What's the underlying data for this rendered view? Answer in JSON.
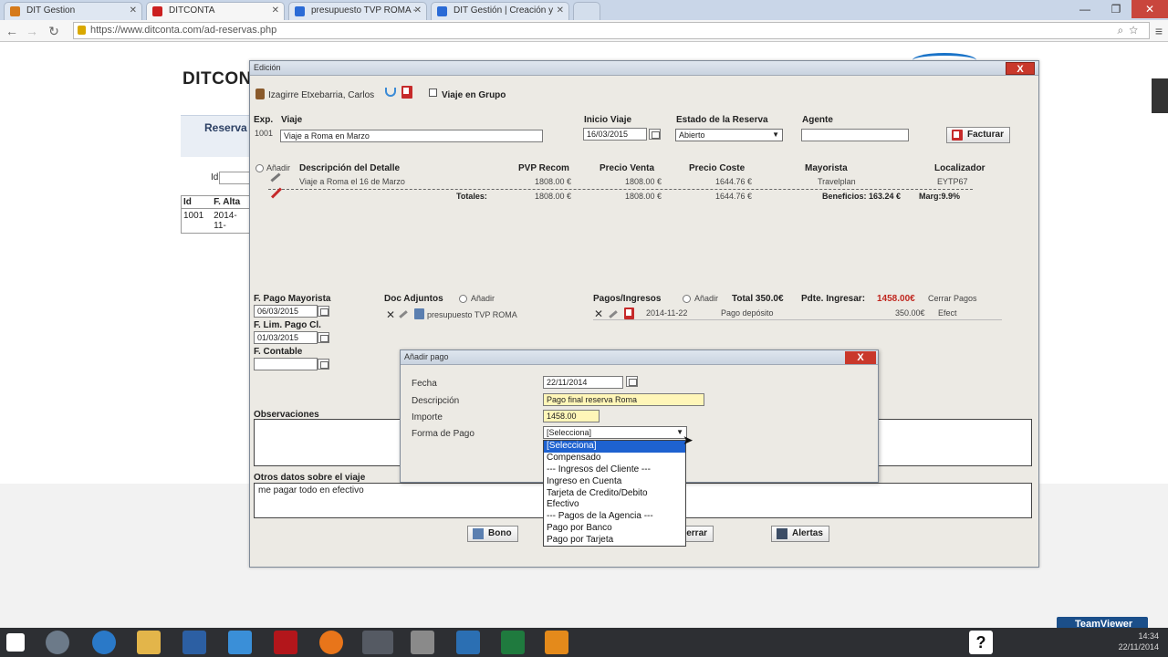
{
  "browser": {
    "tabs": [
      {
        "title": "DIT Gestion",
        "color": "#d57a1b"
      },
      {
        "title": "DITCONTA",
        "color": "#cc2020"
      },
      {
        "title": "presupuesto TVP ROMA -",
        "color": "#2b6bd6"
      },
      {
        "title": "DIT Gestión | Creación y",
        "color": "#2b6bd6"
      }
    ],
    "url": "https://www.ditconta.com/ad-reservas.php",
    "window_controls": [
      "—",
      "❐",
      "✕"
    ]
  },
  "page": {
    "logo": "DITCONTA",
    "nav_label": "Reserva",
    "id_label": "Id",
    "table": {
      "headers": [
        "Id",
        "F. Alta"
      ],
      "rows": [
        [
          "1001",
          "2014-11-"
        ]
      ]
    }
  },
  "edicion": {
    "title": "Edición",
    "close": "X",
    "cliente": "Izagirre Etxebarria, Carlos",
    "viaje_grupo": "Viaje en Grupo",
    "exp_label": "Exp.",
    "exp_value": "1001",
    "viaje_label": "Viaje",
    "viaje_value": "Viaje a Roma en Marzo",
    "inicio_label": "Inicio Viaje",
    "inicio_value": "16/03/2015",
    "estado_label": "Estado de la Reserva",
    "estado_value": "Abierto",
    "agente_label": "Agente",
    "agente_value": "",
    "facturar": "Facturar",
    "detail_headers": {
      "add": "Añadir",
      "desc": "Descripción del Detalle",
      "pvp": "PVP Recom",
      "venta": "Precio Venta",
      "coste": "Precio Coste",
      "mayorista": "Mayorista",
      "localizador": "Localizador"
    },
    "detail_row": {
      "desc": "Viaje a Roma el 16 de Marzo",
      "pvp": "1808.00 €",
      "venta": "1808.00 €",
      "coste": "1644.76 €",
      "mayorista": "Travelplan",
      "localizador": "EYTP67"
    },
    "totals": {
      "label": "Totales:",
      "pvp": "1808.00 €",
      "venta": "1808.00 €",
      "coste": "1644.76 €",
      "beneficios": "Beneficios: 163.24 €",
      "margen": "Marg:9.9%"
    },
    "f_pago_mayorista_label": "F. Pago Mayorista",
    "f_pago_mayorista_value": "06/03/2015",
    "f_lim_pago_label": "F. Lim. Pago Cl.",
    "f_lim_pago_value": "01/03/2015",
    "f_contable_label": "F. Contable",
    "f_contable_value": "",
    "doc_label": "Doc Adjuntos",
    "doc_add": "Añadir",
    "doc_file": "presupuesto TVP ROMA",
    "pagos_label": "Pagos/Ingresos",
    "pagos_add": "Añadir",
    "pagos_total": "Total 350.0€",
    "pagos_pdte": "Pdte. Ingresar:",
    "pagos_pdte_value": "1458.00€",
    "cerrar_pagos": "Cerrar Pagos",
    "pago_row": {
      "fecha": "2014-11-22",
      "concepto": "Pago depósito",
      "importe": "350.00€",
      "forma": "Efect"
    },
    "observaciones_label": "Observaciones",
    "observaciones_value": "",
    "otros_label": "Otros datos sobre el viaje",
    "otros_value": "me pagar todo en efectivo",
    "bono": "Bono",
    "cerrar": "Cerrar",
    "alertas": "Alertas"
  },
  "pago_dialog": {
    "title": "Añadir pago",
    "close": "X",
    "fecha_label": "Fecha",
    "fecha_value": "22/11/2014",
    "desc_label": "Descripción",
    "desc_value": "Pago final reserva Roma",
    "importe_label": "Importe",
    "importe_value": "1458.00",
    "forma_label": "Forma de Pago",
    "forma_value": "[Selecciona]",
    "forma_options": [
      "[Selecciona]",
      "Compensado",
      "--- Ingresos del Cliente ---",
      "Ingreso en Cuenta",
      "Tarjeta de Credito/Debito",
      "Efectivo",
      "--- Pagos de la Agencia ---",
      "Pago por Banco",
      "Pago por Tarjeta"
    ]
  },
  "taskbar": {
    "teamviewer": "TeamViewer",
    "time": "14:34",
    "date": "22/11/2014",
    "help": "?"
  },
  "colors": {
    "dialog_bg": "#eceae4",
    "close_red": "#c9382b",
    "highlight_yellow": "#fff6b8",
    "selection_blue": "#1e62d0",
    "pdte_red": "#c0271f"
  }
}
